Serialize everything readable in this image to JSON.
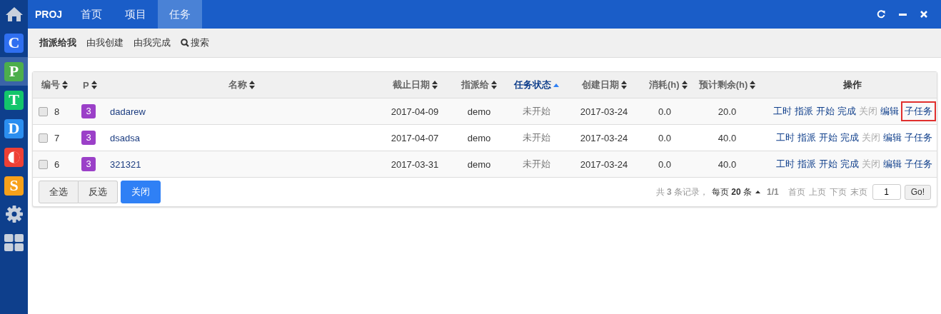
{
  "sidebar": {
    "items": [
      {
        "kind": "home",
        "selected": false
      },
      {
        "kind": "letter",
        "letter": "C",
        "color": "#2f6ff0",
        "selected": false
      },
      {
        "kind": "letter",
        "letter": "P",
        "color": "#4cae4c",
        "selected": true
      },
      {
        "kind": "letter",
        "letter": "T",
        "color": "#13c56b",
        "selected": false
      },
      {
        "kind": "letter",
        "letter": "D",
        "color": "#2b8ef0",
        "selected": false
      },
      {
        "kind": "half",
        "color": "#ee4035",
        "selected": false
      },
      {
        "kind": "letter",
        "letter": "S",
        "color": "#f7a11a",
        "selected": false
      },
      {
        "kind": "gear",
        "selected": false
      },
      {
        "kind": "grid",
        "selected": false
      }
    ]
  },
  "topbar": {
    "brand": "PROJ",
    "tabs": [
      {
        "label": "首页",
        "selected": false
      },
      {
        "label": "项目",
        "selected": false
      },
      {
        "label": "任务",
        "selected": true
      }
    ]
  },
  "subnav": {
    "items": [
      {
        "label": "指派给我",
        "selected": true
      },
      {
        "label": "由我创建",
        "selected": false
      },
      {
        "label": "由我完成",
        "selected": false
      }
    ],
    "search": "搜索"
  },
  "table": {
    "columns": [
      {
        "label": "编号",
        "sortable": true,
        "sorted": false
      },
      {
        "label": "P",
        "sortable": true,
        "sorted": false
      },
      {
        "label": "名称",
        "sortable": true,
        "sorted": false
      },
      {
        "label": "截止日期",
        "sortable": true,
        "sorted": false
      },
      {
        "label": "指派给",
        "sortable": true,
        "sorted": false
      },
      {
        "label": "任务状态",
        "sortable": true,
        "sorted": true
      },
      {
        "label": "创建日期",
        "sortable": true,
        "sorted": false
      },
      {
        "label": "消耗(h)",
        "sortable": true,
        "sorted": false
      },
      {
        "label": "预计剩余(h)",
        "sortable": true,
        "sorted": false
      },
      {
        "label": "操作",
        "sortable": false,
        "sorted": false
      }
    ],
    "rows": [
      {
        "checked": false,
        "id": "8",
        "priority": "3",
        "name": "dadarew",
        "deadline": "2017-04-09",
        "assignee": "demo",
        "status": "未开始",
        "created": "2017-03-24",
        "consumed": "0.0",
        "remaining": "20.0",
        "actions": [
          {
            "label": "工时",
            "disabled": false,
            "highlighted": false
          },
          {
            "label": "指派",
            "disabled": false,
            "highlighted": false
          },
          {
            "label": "开始",
            "disabled": false,
            "highlighted": false
          },
          {
            "label": "完成",
            "disabled": false,
            "highlighted": false
          },
          {
            "label": "关闭",
            "disabled": true,
            "highlighted": false
          },
          {
            "label": "编辑",
            "disabled": false,
            "highlighted": false
          },
          {
            "label": "子任务",
            "disabled": false,
            "highlighted": true
          }
        ]
      },
      {
        "checked": false,
        "id": "7",
        "priority": "3",
        "name": "dsadsa",
        "deadline": "2017-04-07",
        "assignee": "demo",
        "status": "未开始",
        "created": "2017-03-24",
        "consumed": "0.0",
        "remaining": "40.0",
        "actions": [
          {
            "label": "工时",
            "disabled": false,
            "highlighted": false
          },
          {
            "label": "指派",
            "disabled": false,
            "highlighted": false
          },
          {
            "label": "开始",
            "disabled": false,
            "highlighted": false
          },
          {
            "label": "完成",
            "disabled": false,
            "highlighted": false
          },
          {
            "label": "关闭",
            "disabled": true,
            "highlighted": false
          },
          {
            "label": "编辑",
            "disabled": false,
            "highlighted": false
          },
          {
            "label": "子任务",
            "disabled": false,
            "highlighted": false
          }
        ]
      },
      {
        "checked": false,
        "id": "6",
        "priority": "3",
        "name": "321321",
        "deadline": "2017-03-31",
        "assignee": "demo",
        "status": "未开始",
        "created": "2017-03-24",
        "consumed": "0.0",
        "remaining": "40.0",
        "actions": [
          {
            "label": "工时",
            "disabled": false,
            "highlighted": false
          },
          {
            "label": "指派",
            "disabled": false,
            "highlighted": false
          },
          {
            "label": "开始",
            "disabled": false,
            "highlighted": false
          },
          {
            "label": "完成",
            "disabled": false,
            "highlighted": false
          },
          {
            "label": "关闭",
            "disabled": true,
            "highlighted": false
          },
          {
            "label": "编辑",
            "disabled": false,
            "highlighted": false
          },
          {
            "label": "子任务",
            "disabled": false,
            "highlighted": false
          }
        ]
      }
    ]
  },
  "footer": {
    "buttons": [
      {
        "label": "全选",
        "kind": "default"
      },
      {
        "label": "反选",
        "kind": "default"
      },
      {
        "label": "关闭",
        "kind": "primary"
      }
    ],
    "pager": {
      "summary": "共 **3** 条记录，",
      "page_size": "每页 **20** 条",
      "page": "1/1",
      "links": [
        "首页",
        "上页",
        "下页",
        "末页"
      ],
      "page_input": "1",
      "go": "Go!"
    }
  }
}
